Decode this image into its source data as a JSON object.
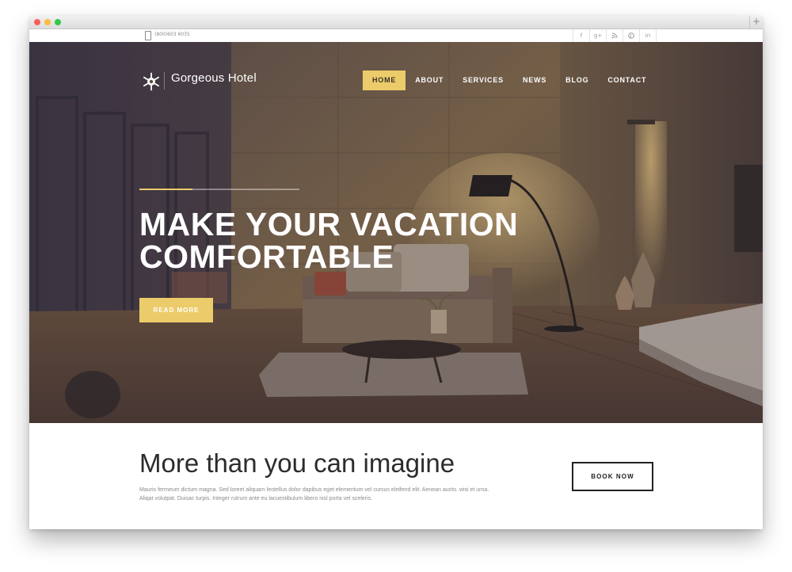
{
  "topbar": {
    "phone": "(800)603 6035",
    "social": [
      "f",
      "g+",
      "rss",
      "p",
      "in"
    ]
  },
  "header": {
    "logo_text": "Gorgeous Hotel",
    "logo_icon": "snowflake-emblem-icon",
    "nav": [
      "HOME",
      "ABOUT",
      "SERVICES",
      "NEWS",
      "BLOG",
      "CONTACT"
    ],
    "active_nav": "HOME"
  },
  "hero": {
    "title_line1": "MAKE YOUR VACATION",
    "title_line2": "COMFORTABLE",
    "button": "READ MORE"
  },
  "section": {
    "title": "More than you can imagine",
    "text_line1": "Mauris fermeum dictum magna. Sed loreet aliquam leotellus dolor dapibus eget elementum vel cursus eleifend elit. Aenean aucto. wisi et urna.",
    "text_line2": "Aliqat volutpat. Duisac turpis. Integer rutrum ante eu lacuestibulum libero nisl porta vel sceleris.",
    "button": "BOOK NOW"
  },
  "colors": {
    "accent": "#eccc6a",
    "dark_text": "#2c2c2c"
  }
}
